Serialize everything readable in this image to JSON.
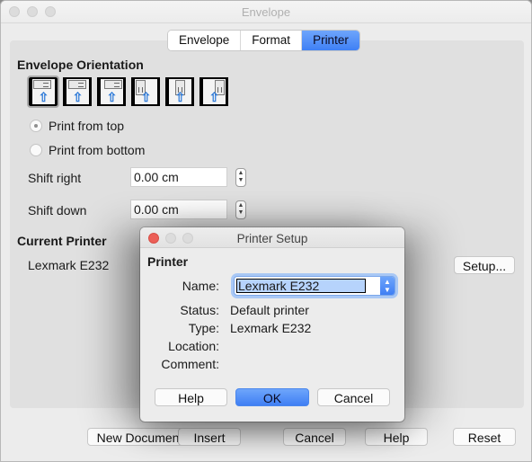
{
  "window": {
    "title": "Envelope",
    "tabs": [
      {
        "label": "Envelope",
        "active": false
      },
      {
        "label": "Format",
        "active": false
      },
      {
        "label": "Printer",
        "active": true
      }
    ]
  },
  "printer_tab": {
    "orientation": {
      "title": "Envelope Orientation",
      "options": [
        {
          "name": "horizontal-left",
          "selected": true
        },
        {
          "name": "horizontal-center",
          "selected": false
        },
        {
          "name": "horizontal-right",
          "selected": false
        },
        {
          "name": "vertical-left",
          "selected": false
        },
        {
          "name": "vertical-center",
          "selected": false
        },
        {
          "name": "vertical-right",
          "selected": false
        }
      ],
      "print_from_top": "Print from top",
      "print_from_bottom": "Print from bottom",
      "selected_radio": "print_from_top"
    },
    "shift_right": {
      "label": "Shift right",
      "value": "0.00 cm"
    },
    "shift_down": {
      "label": "Shift down",
      "value": "0.00 cm"
    },
    "current_printer": {
      "title": "Current Printer",
      "name": "Lexmark E232",
      "setup_button": "Setup..."
    }
  },
  "footer_buttons": {
    "new_document": "New Document",
    "insert": "Insert",
    "cancel": "Cancel",
    "help": "Help",
    "reset": "Reset"
  },
  "printer_setup_dialog": {
    "title": "Printer Setup",
    "section_title": "Printer",
    "name_label": "Name:",
    "name_value": "Lexmark E232",
    "status_label": "Status:",
    "status_value": "Default printer",
    "type_label": "Type:",
    "type_value": "Lexmark E232",
    "location_label": "Location:",
    "location_value": "",
    "comment_label": "Comment:",
    "comment_value": "",
    "help_button": "Help",
    "ok_button": "OK",
    "cancel_button": "Cancel"
  },
  "icons": {
    "arrow": "up-arrow",
    "spinner_up": "⌃",
    "spinner_down": "⌄"
  }
}
